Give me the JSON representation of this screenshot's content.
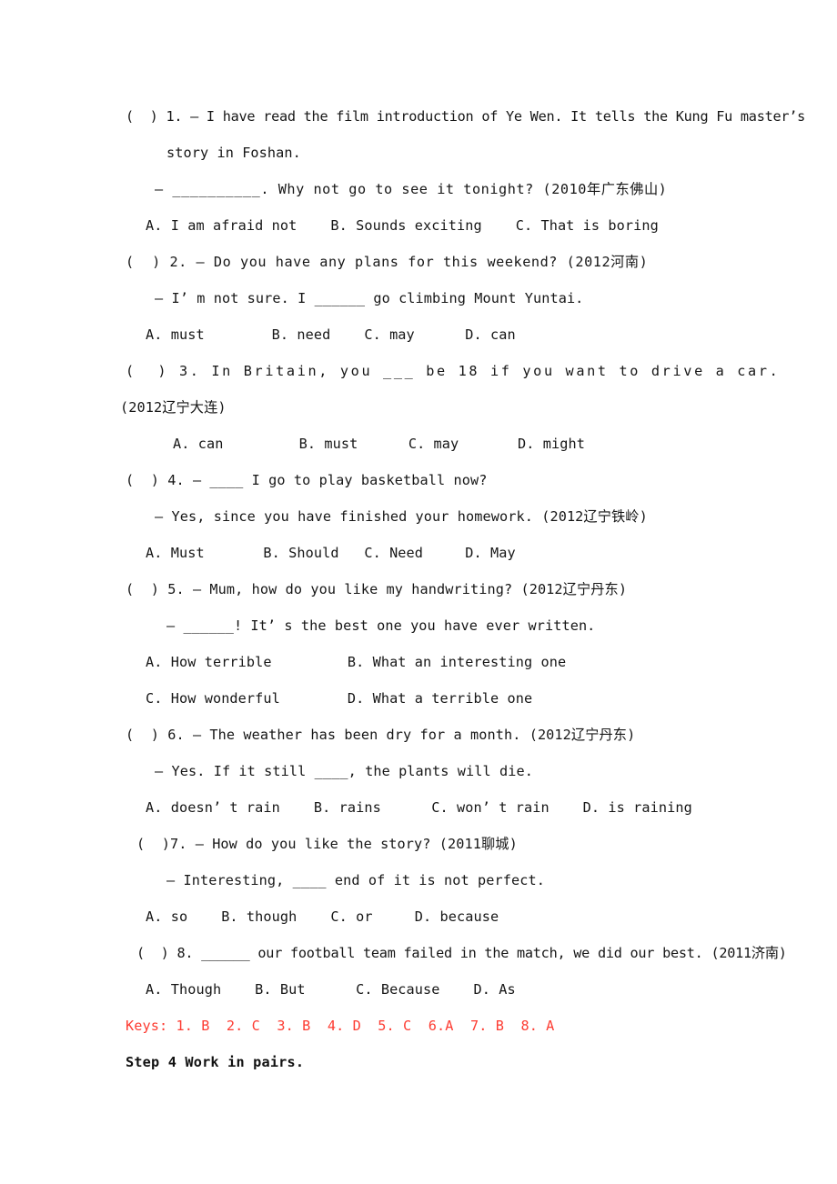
{
  "document": {
    "type": "english-exam-worksheet",
    "colors": {
      "text": "#161616",
      "keys_red": "#fd3c32",
      "background": "#ffffff"
    },
    "lines": [
      {
        "id": "q1-stem-1",
        "text": "(  ) 1. — I have read the film introduction of Ye Wen. It tells the Kung Fu master’s"
      },
      {
        "id": "q1-stem-2",
        "text": "story in Foshan."
      },
      {
        "id": "q1-stem-3",
        "text": "— __________. Why not go to see it tonight? (2010年广东佛山)"
      },
      {
        "id": "q1-options",
        "text": "A. I am afraid not    B. Sounds exciting    C. That is boring"
      },
      {
        "id": "q2-stem-1",
        "text": "(  ) 2. — Do you have any plans for this weekend? (2012河南)"
      },
      {
        "id": "q2-stem-2",
        "text": "— I’ m not sure. I ______ go climbing Mount Yuntai."
      },
      {
        "id": "q2-options",
        "text": "A. must        B. need    C. may      D. can"
      },
      {
        "id": "q3-stem-1",
        "text": "(  ) 3. In Britain, you ___ be 18 if you want to drive a car."
      },
      {
        "id": "q3-stem-2",
        "text": "(2012辽宁大连)"
      },
      {
        "id": "q3-options",
        "text": "A. can         B. must      C. may       D. might"
      },
      {
        "id": "q4-stem-1",
        "text": "(  ) 4. — ____ I go to play basketball now?"
      },
      {
        "id": "q4-stem-2",
        "text": "— Yes, since you have finished your homework. (2012辽宁铁岭)"
      },
      {
        "id": "q4-options",
        "text": "A. Must       B. Should   C. Need     D. May"
      },
      {
        "id": "q5-stem-1",
        "text": "(  ) 5. — Mum, how do you like my handwriting? (2012辽宁丹东)"
      },
      {
        "id": "q5-stem-2",
        "text": "— ______! It’ s the best one you have ever written."
      },
      {
        "id": "q5-options-ab",
        "text": "A. How terrible         B. What an interesting one"
      },
      {
        "id": "q5-options-cd",
        "text": "C. How wonderful        D. What a terrible one"
      },
      {
        "id": "q6-stem-1",
        "text": "(  ) 6. — The weather has been dry for a month. (2012辽宁丹东)"
      },
      {
        "id": "q6-stem-2",
        "text": "— Yes. If it still ____, the plants will die."
      },
      {
        "id": "q6-options",
        "text": "A. doesn’ t rain    B. rains      C. won’ t rain    D. is raining"
      },
      {
        "id": "q7-stem-1",
        "text": "(  )7. — How do you like the story? (2011聊城)"
      },
      {
        "id": "q7-stem-2",
        "text": "— Interesting, ____ end of it is not perfect."
      },
      {
        "id": "q7-options",
        "text": "A. so    B. though    C. or     D. because"
      },
      {
        "id": "q8-stem-1",
        "text": "(  ) 8. ______ our football team failed in the match, we did our best. (2011济南)"
      },
      {
        "id": "q8-options",
        "text": "A. Though    B. But      C. Because    D. As"
      },
      {
        "id": "keys",
        "text": "Keys: 1. B  2. C  3. B  4. D  5. C  6.A  7. B  8. A"
      },
      {
        "id": "step4",
        "text": "Step 4 Work in pairs."
      }
    ]
  }
}
